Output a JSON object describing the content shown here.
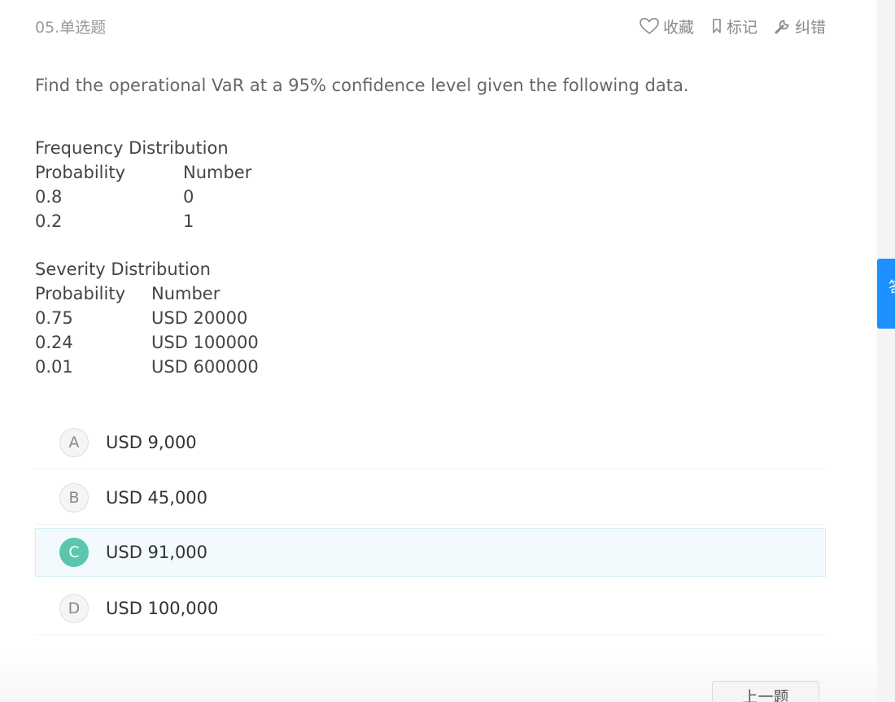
{
  "header": {
    "question_number": "05.单选题",
    "favorite_label": "收藏",
    "mark_label": "标记",
    "report_label": "纠错"
  },
  "question": {
    "text": "Find the operational VaR at a 95% confidence level given the following data."
  },
  "frequency": {
    "title": "Frequency Distribution",
    "headers": [
      "Probability",
      "Number"
    ],
    "rows": [
      [
        "0.8",
        "0"
      ],
      [
        "0.2",
        "1"
      ]
    ]
  },
  "severity": {
    "title": "Severity Distribution",
    "headers": [
      "Probability",
      "Number"
    ],
    "rows": [
      [
        "0.75",
        "USD 20000"
      ],
      [
        "0.24",
        "USD 100000"
      ],
      [
        "0.01",
        "USD 600000"
      ]
    ]
  },
  "options": [
    {
      "letter": "A",
      "text": "USD 9,000",
      "selected": false
    },
    {
      "letter": "B",
      "text": "USD 45,000",
      "selected": false
    },
    {
      "letter": "C",
      "text": "USD 91,000",
      "selected": true
    },
    {
      "letter": "D",
      "text": "USD 100,000",
      "selected": false
    }
  ],
  "footer": {
    "prev_label": "上一题"
  },
  "side_tab": {
    "label": "答题卡"
  },
  "colors": {
    "selected_accent": "#5bc6ad",
    "selected_background": "#f3fafd",
    "side_tab": "#1e90ff"
  },
  "icons": {
    "favorite": "heart-icon",
    "mark": "bookmark-icon",
    "report": "wrench-icon"
  }
}
